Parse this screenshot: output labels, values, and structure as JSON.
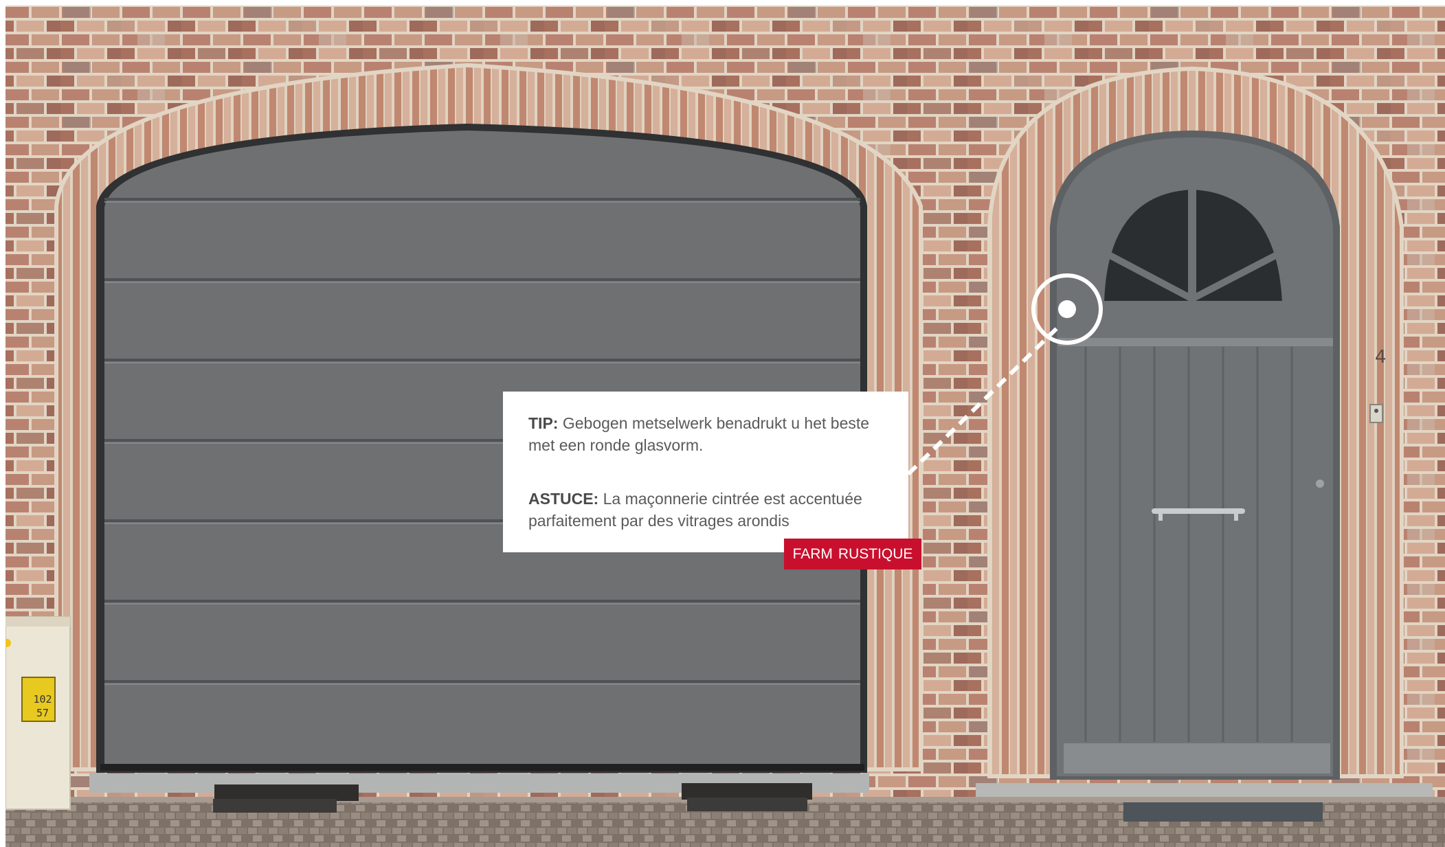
{
  "tip": {
    "tip_label": "TIP:",
    "tip_text": "Gebogen metselwerk benadrukt u het beste met een ronde glasvorm.",
    "astuce_label": "ASTUCE:",
    "astuce_text": "La maçonnerie cintrée est accentuée parfaitement par des vitrages arondis"
  },
  "tag": {
    "word1": "FARM",
    "word2": "RUSTIQUE"
  },
  "meter_box": {
    "line1": "102",
    "line2": "57"
  },
  "colors": {
    "brick": "#b7806a",
    "mortar": "#e4d6c6",
    "garage_door": "#6e7072",
    "front_door": "#6f7375",
    "accent_red": "#c8102e",
    "paving": "#8e8378"
  }
}
